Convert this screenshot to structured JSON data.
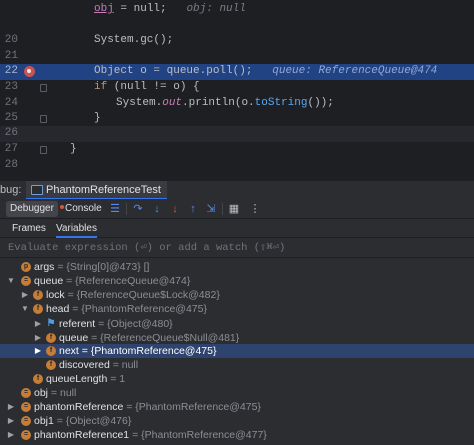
{
  "editor": {
    "lines": [
      {
        "num": "",
        "code_obj": "obj",
        "code_rest": " = null;",
        "hint": "obj: null"
      },
      {
        "num": "20",
        "code": "System.gc();"
      },
      {
        "num": "21",
        "code": ""
      },
      {
        "num": "22",
        "code": "Object o = queue.poll();",
        "hint": "queue: ReferenceQueue@474"
      },
      {
        "num": "23",
        "code_kw": "if",
        "code_rest": " (null != o) {"
      },
      {
        "num": "24",
        "code_sys": "System.",
        "code_out": "out",
        "code_print": ".println(o.",
        "code_fn": "toString",
        "code_end": "());"
      },
      {
        "num": "25",
        "code": "}"
      },
      {
        "num": "26",
        "code": ""
      },
      {
        "num": "27",
        "code": "}"
      },
      {
        "num": "28",
        "code": ""
      }
    ]
  },
  "debug": {
    "label": "bug:",
    "session_tab": "PhantomReferenceTest",
    "toolbar": {
      "debugger_tab": "Debugger",
      "console_tab": "Console"
    },
    "subtabs": {
      "frames": "Frames",
      "variables": "Variables"
    },
    "eval_placeholder": "Evaluate expression (⏎) or add a watch (⇧⌘⏎)"
  },
  "variables": [
    {
      "name": "args",
      "value": "{String[0]@473} []"
    },
    {
      "name": "queue",
      "value": "{ReferenceQueue@474}"
    },
    {
      "name": "lock",
      "value": "{ReferenceQueue$Lock@482}"
    },
    {
      "name": "head",
      "value": "{PhantomReference@475}"
    },
    {
      "name": "referent",
      "value": "{Object@480}"
    },
    {
      "name": "queue",
      "value": "{ReferenceQueue$Null@481}"
    },
    {
      "name": "next",
      "value": "{PhantomReference@475}"
    },
    {
      "name": "discovered",
      "value": "null"
    },
    {
      "name": "queueLength",
      "value": "1"
    },
    {
      "name": "obj",
      "value": "null"
    },
    {
      "name": "phantomReference",
      "value": "{PhantomReference@475}"
    },
    {
      "name": "obj1",
      "value": "{Object@476}"
    },
    {
      "name": "phantomReference1",
      "value": "{PhantomReference@477}"
    }
  ]
}
